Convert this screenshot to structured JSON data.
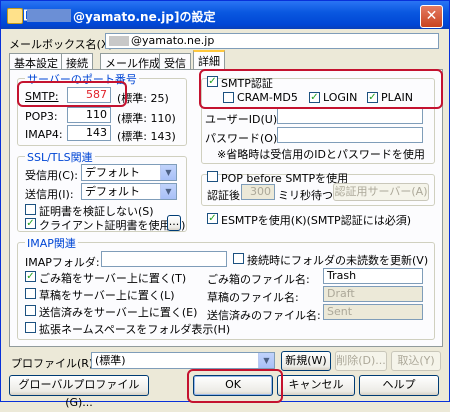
{
  "window": {
    "title": "@yamato.ne.jp]の設定",
    "bracket": "["
  },
  "mailbox": {
    "label": "メールボックス名(X):",
    "value": "@yamato.ne.jp"
  },
  "tabs": [
    "基本設定",
    "接続",
    "メール作成",
    "受信",
    "詳細"
  ],
  "ports": {
    "group_label": "サーバーのポート番号",
    "smtp": {
      "label": "SMTP:",
      "value": "587",
      "default": "(標準: 25)"
    },
    "pop3": {
      "label": "POP3:",
      "value": "110",
      "default": "(標準: 110)"
    },
    "imap4": {
      "label": "IMAP4:",
      "value": "143",
      "default": "(標準: 143)"
    }
  },
  "ssl": {
    "group_label": "SSL/TLS関連",
    "recv_label": "受信用(C):",
    "recv_value": "デフォルト",
    "send_label": "送信用(I):",
    "send_value": "デフォルト",
    "verify_cert": "証明書を検証しない(S)",
    "client_cert": "クライアント証明書を使用(F)",
    "browse": "..."
  },
  "smtp_auth": {
    "label": "SMTP認証",
    "cram": "CRAM-MD5",
    "login": "LOGIN",
    "plain": "PLAIN",
    "user_label": "ユーザーID(U):",
    "pass_label": "パスワード(O):",
    "note": "※省略時は受信用のIDとパスワードを使用"
  },
  "pop_before": {
    "label": "POP before SMTPを使用",
    "wait_label": "認証後",
    "wait_value": "300",
    "wait_unit": "ミリ秒待つ",
    "server_button": "認証用サーバー(A)"
  },
  "esmtp": {
    "label": "ESMTPを使用(K)(SMTP認証には必須)"
  },
  "imap": {
    "group_label": "IMAP関連",
    "folder_label": "IMAPフォルダ:",
    "unread": "接続時にフォルダの未読数を更新(V)",
    "trash_cb": "ごみ箱をサーバー上に置く(T)",
    "draft_cb": "草稿をサーバー上に置く(L)",
    "sent_cb": "送信済みをサーバー上に置く(E)",
    "ns_cb": "拡張ネームスペースをフォルダ表示(H)",
    "trash_label": "ごみ箱のファイル名:",
    "trash_value": "Trash",
    "draft_label": "草稿のファイル名:",
    "draft_value": "Draft",
    "sent_label": "送信済みのファイル名:",
    "sent_value": "Sent"
  },
  "profile": {
    "label": "プロファイル(R):",
    "value": "(標準)",
    "new": "新規(W)",
    "delete": "削除(D)...",
    "import": "取込(Y)"
  },
  "footer": {
    "global": "グローバルプロファイル(G)...",
    "ok": "OK",
    "cancel": "キャンセル",
    "help": "ヘルプ"
  },
  "colors": {
    "highlight": "#c4122f",
    "title_bar": "#0046d5"
  }
}
